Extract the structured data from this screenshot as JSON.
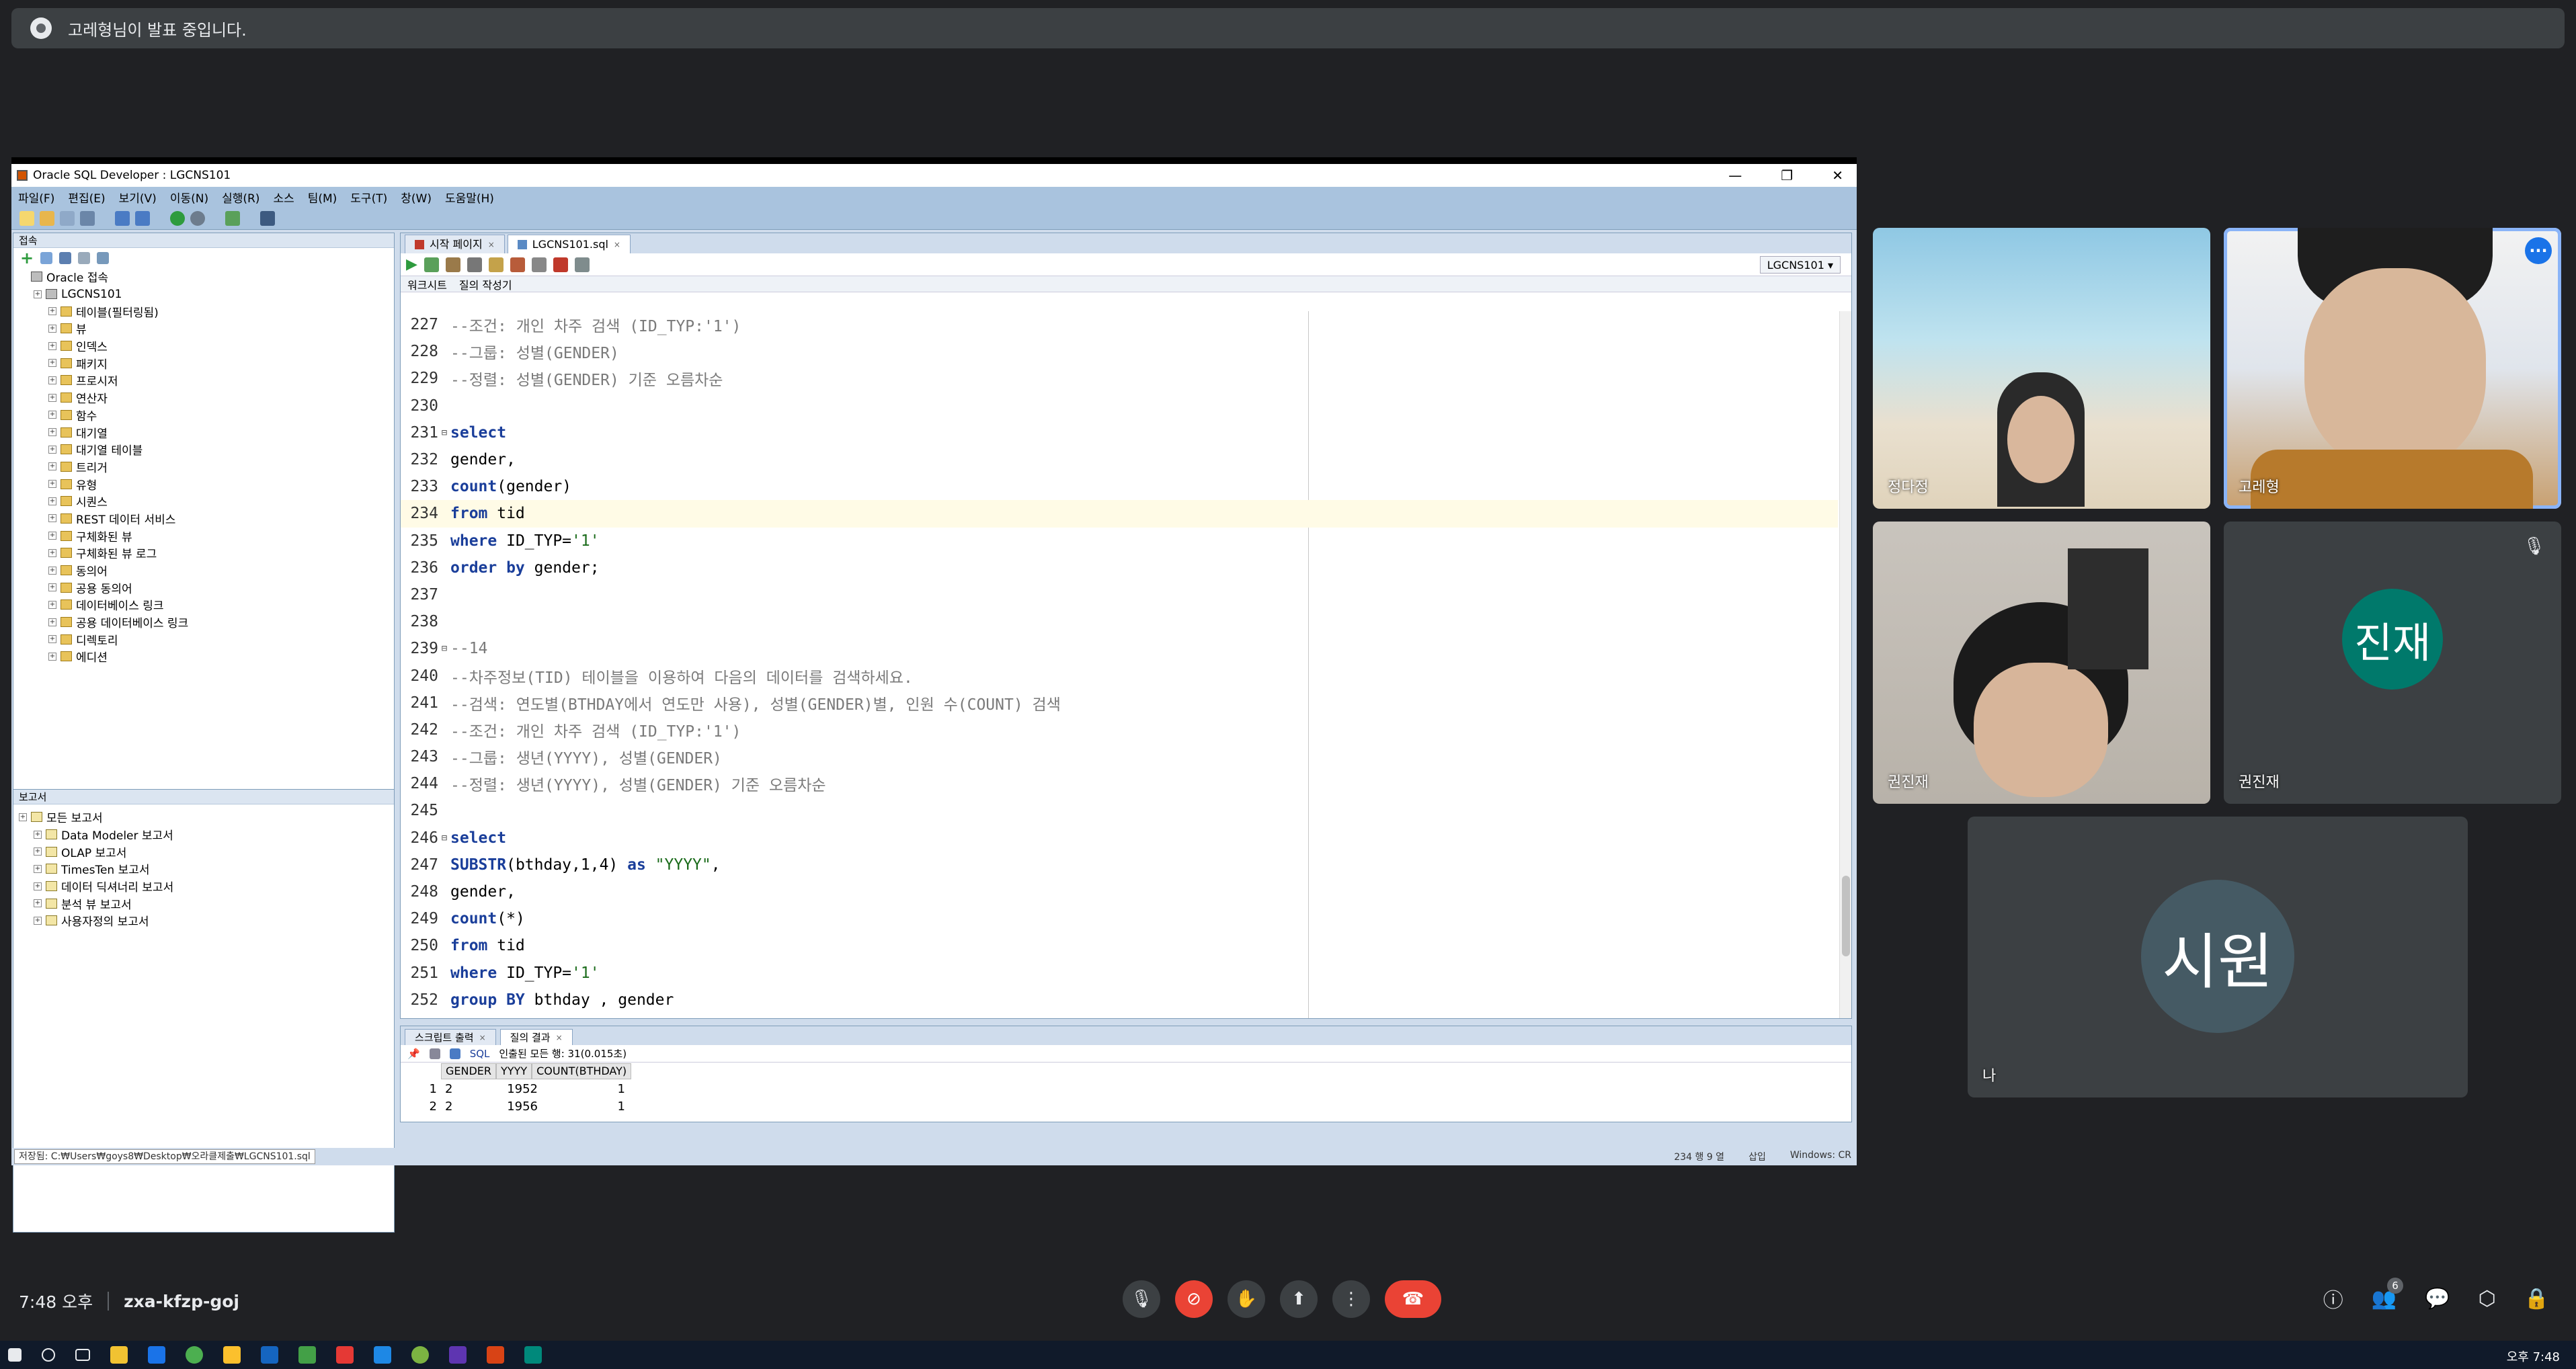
{
  "banner": {
    "text": "고레형님이 발표 중입니다."
  },
  "window": {
    "title": "Oracle SQL Developer : LGCNS101",
    "menu": [
      "파일(F)",
      "편집(E)",
      "보기(V)",
      "이동(N)",
      "실행(R)",
      "소스",
      "팀(M)",
      "도구(T)",
      "창(W)",
      "도움말(H)"
    ]
  },
  "left": {
    "header": "접속",
    "tree": [
      {
        "label": "Oracle 접속",
        "level": 0,
        "kind": "db"
      },
      {
        "label": "LGCNS101",
        "level": 1,
        "kind": "db"
      },
      {
        "label": "테이블(필터링됨)",
        "level": 2
      },
      {
        "label": "뷰",
        "level": 2
      },
      {
        "label": "인덱스",
        "level": 2
      },
      {
        "label": "패키지",
        "level": 2
      },
      {
        "label": "프로시저",
        "level": 2
      },
      {
        "label": "연산자",
        "level": 2
      },
      {
        "label": "함수",
        "level": 2
      },
      {
        "label": "대기열",
        "level": 2
      },
      {
        "label": "대기열 테이블",
        "level": 2
      },
      {
        "label": "트리거",
        "level": 2
      },
      {
        "label": "유형",
        "level": 2
      },
      {
        "label": "시퀀스",
        "level": 2
      },
      {
        "label": "REST 데이터 서비스",
        "level": 2
      },
      {
        "label": "구체화된 뷰",
        "level": 2
      },
      {
        "label": "구체화된 뷰 로그",
        "level": 2
      },
      {
        "label": "동의어",
        "level": 2
      },
      {
        "label": "공용 동의어",
        "level": 2
      },
      {
        "label": "데이터베이스 링크",
        "level": 2
      },
      {
        "label": "공용 데이터베이스 링크",
        "level": 2
      },
      {
        "label": "디렉토리",
        "level": 2
      },
      {
        "label": "에디션",
        "level": 2
      }
    ],
    "reports_header": "보고서",
    "reports": [
      {
        "label": "모든 보고서",
        "level": 0
      },
      {
        "label": "Data Modeler 보고서",
        "level": 1
      },
      {
        "label": "OLAP 보고서",
        "level": 1
      },
      {
        "label": "TimesTen 보고서",
        "level": 1
      },
      {
        "label": "데이터 딕셔너리 보고서",
        "level": 1
      },
      {
        "label": "분석 뷰 보고서",
        "level": 1
      },
      {
        "label": "사용자정의 보고서",
        "level": 1
      }
    ]
  },
  "editor": {
    "tabs": [
      {
        "label": "시작 페이지",
        "active": false
      },
      {
        "label": "LGCNS101.sql",
        "active": true
      }
    ],
    "connection": "LGCNS101",
    "subtabs": [
      "워크시트",
      "질의 작성기"
    ],
    "lines": [
      {
        "n": "227",
        "t": "--조건: 개인 차주 검색 (ID_TYP:'1')",
        "c": "cm"
      },
      {
        "n": "228",
        "t": "--그룹: 성별(GENDER)",
        "c": "cm"
      },
      {
        "n": "229",
        "t": "--정렬: 성별(GENDER) 기준 오름차순",
        "c": "cm"
      },
      {
        "n": "230",
        "t": "",
        "c": ""
      },
      {
        "n": "231",
        "t": "select",
        "c": "kw",
        "fold": "⊟"
      },
      {
        "n": "232",
        "t": "gender,",
        "c": ""
      },
      {
        "n": "233",
        "t": "count(gender)",
        "c": "fn"
      },
      {
        "n": "234",
        "t": "from tid",
        "c": "from",
        "hl": true
      },
      {
        "n": "235",
        "t": "where ID_TYP='1'",
        "c": "where"
      },
      {
        "n": "236",
        "t": "order by gender;",
        "c": "order"
      },
      {
        "n": "237",
        "t": "",
        "c": ""
      },
      {
        "n": "238",
        "t": "",
        "c": ""
      },
      {
        "n": "239",
        "t": "--14",
        "c": "cm",
        "fold": "⊟"
      },
      {
        "n": "240",
        "t": "--차주정보(TID) 테이블을 이용하여 다음의 데이터를 검색하세요.",
        "c": "cm"
      },
      {
        "n": "241",
        "t": "--검색: 연도별(BTHDAY에서 연도만 사용), 성별(GENDER)별, 인원 수(COUNT) 검색",
        "c": "cm"
      },
      {
        "n": "242",
        "t": "--조건: 개인 차주 검색 (ID_TYP:'1')",
        "c": "cm"
      },
      {
        "n": "243",
        "t": "--그룹: 생년(YYYY), 성별(GENDER)",
        "c": "cm"
      },
      {
        "n": "244",
        "t": "--정렬: 생년(YYYY), 성별(GENDER) 기준 오름차순",
        "c": "cm"
      },
      {
        "n": "245",
        "t": "",
        "c": ""
      },
      {
        "n": "246",
        "t": "select",
        "c": "kw",
        "fold": "⊟"
      },
      {
        "n": "247",
        "t": "SUBSTR(bthday,1,4) as \"YYYY\",",
        "c": "substr"
      },
      {
        "n": "248",
        "t": "gender,",
        "c": ""
      },
      {
        "n": "249",
        "t": "count(*)",
        "c": "fn"
      },
      {
        "n": "250",
        "t": "from tid",
        "c": "from"
      },
      {
        "n": "251",
        "t": "where ID_TYP='1'",
        "c": "where"
      },
      {
        "n": "252",
        "t": "group BY bthday , gender",
        "c": "group"
      }
    ]
  },
  "results": {
    "tabs": [
      "스크립트 출력",
      "질의 결과"
    ],
    "sql_label": "SQL",
    "fetch_info": "인출된 모든 행: 31(0.015초)",
    "columns": [
      "GENDER",
      "YYYY",
      "COUNT(BTHDAY)"
    ],
    "rows": [
      [
        "1",
        "2",
        "1952",
        "1"
      ],
      [
        "2",
        "2",
        "1956",
        "1"
      ]
    ]
  },
  "status": {
    "path": "저장됨: C:₩Users₩goys8₩Desktop₩오라클제출₩LGCNS101.sql",
    "position": "234 행 9 열",
    "mode": "삽입",
    "eol": "Windows: CR"
  },
  "participants": [
    {
      "name": "정다정",
      "kind": "video-beach"
    },
    {
      "name": "고레형",
      "kind": "video-pinned"
    },
    {
      "name": "권진재",
      "kind": "video-room"
    },
    {
      "name": "권진재",
      "kind": "avatar",
      "initial": "진재",
      "color": "#00796b",
      "muted": true
    },
    {
      "name": "나",
      "kind": "avatar",
      "initial": "시원",
      "color": "#455a64"
    }
  ],
  "bottom": {
    "time": "7:48 오후",
    "meeting_code": "zxa-kfzp-goj",
    "people_count": "6"
  },
  "taskbar": {
    "clock": "오후 7:48"
  }
}
